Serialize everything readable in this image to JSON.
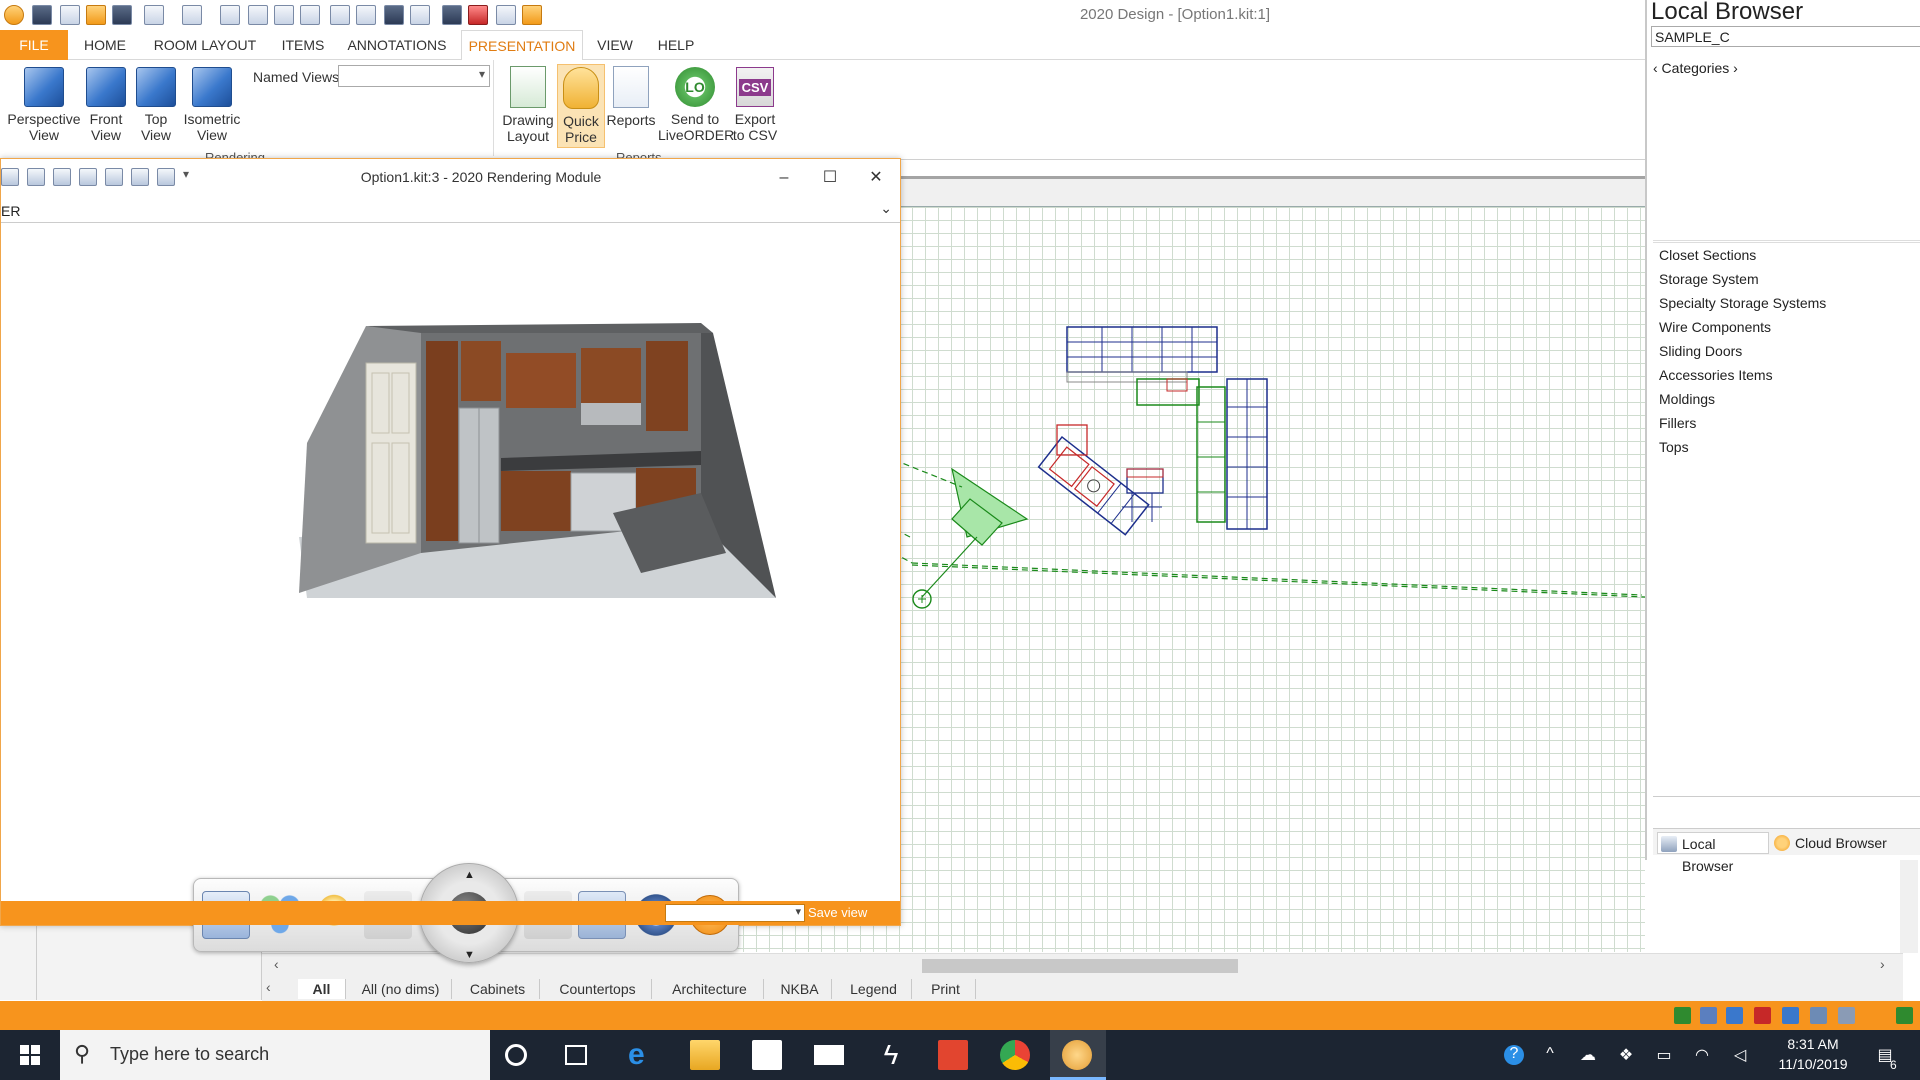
{
  "app": {
    "title": "2020 Design - [Option1.kit:1]"
  },
  "ribbon": {
    "tabs": [
      "FILE",
      "HOME",
      "ROOM LAYOUT",
      "ITEMS",
      "ANNOTATIONS",
      "PRESENTATION",
      "VIEW",
      "HELP"
    ],
    "active_tab": "PRESENTATION",
    "views": [
      {
        "line1": "Perspective",
        "line2": "View"
      },
      {
        "line1": "Front",
        "line2": "View"
      },
      {
        "line1": "Top",
        "line2": "View"
      },
      {
        "line1": "Isometric",
        "line2": "View"
      }
    ],
    "named_views_label": "Named Views",
    "named_views_value": "",
    "group_rendering": "Rendering",
    "group_reports": "Reports",
    "actions": [
      {
        "line1": "Drawing",
        "line2": "Layout"
      },
      {
        "line1": "Quick",
        "line2": "Price"
      },
      {
        "line1": "Reports",
        "line2": ""
      },
      {
        "line1": "Send to",
        "line2": "LiveORDER"
      },
      {
        "line1": "Export",
        "line2": "to CSV"
      }
    ],
    "lo_icon_text": "LO",
    "csv_icon_text": "CSV"
  },
  "rendering_module": {
    "title": "Option1.kit:3 - 2020 Rendering Module",
    "subbar_text": "ER",
    "save_view_label": "Save view",
    "save_view_value": ""
  },
  "local_browser": {
    "title": "Local Browser",
    "search_value": "SAMPLE_C",
    "categories_label": "‹ Categories ›",
    "items": [
      "Closet Sections",
      "Storage System",
      "Specialty Storage Systems",
      "Wire Components",
      "Sliding Doors",
      "Accessories Items",
      "Moldings",
      "Fillers",
      "Tops"
    ],
    "tabs": [
      "Local Browser",
      "Cloud Browser"
    ]
  },
  "view_tabs": [
    "All",
    "All (no dims)",
    "Cabinets",
    "Countertops",
    "Architecture",
    "NKBA",
    "Legend",
    "Print"
  ],
  "taskbar": {
    "search_placeholder": "Type here to search",
    "time": "8:31 AM",
    "date": "11/10/2019",
    "notification_count": "6"
  }
}
